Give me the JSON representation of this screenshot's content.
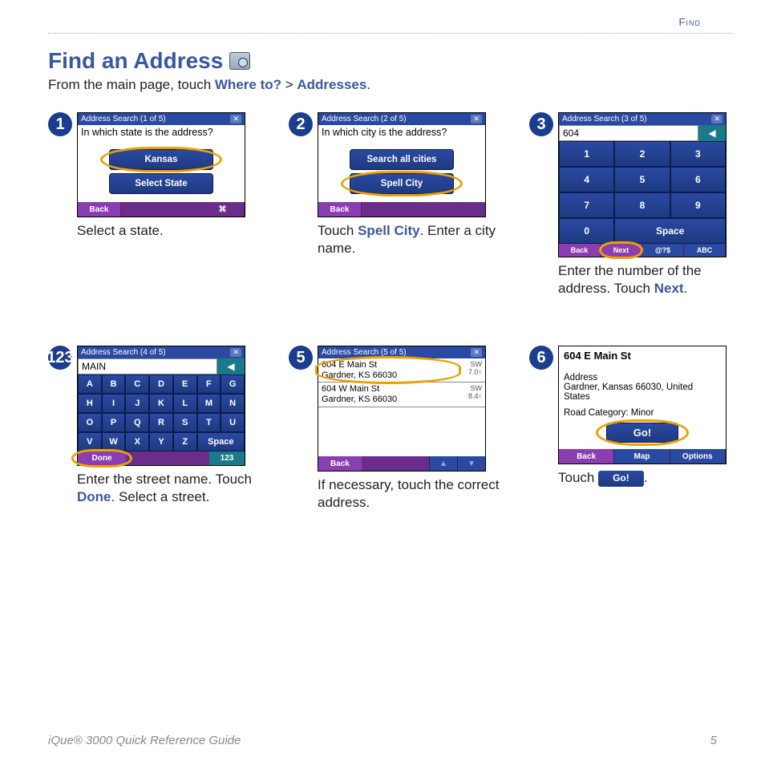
{
  "sectionTab": "Find",
  "heading": "Find an Address",
  "introPre": "From the main page, touch ",
  "introLink1": "Where to?",
  "introMid": " > ",
  "introLink2": "Addresses",
  "introPost": ".",
  "steps": {
    "s1": {
      "num": "1",
      "title": "Address Search  (1 of 5)",
      "prompt": "In which state is the address?",
      "btn1": "Kansas",
      "btn2": "Select State",
      "back": "Back",
      "caption": "Select a state."
    },
    "s2": {
      "num": "2",
      "title": "Address Search  (2 of 5)",
      "prompt": "In which city is the address?",
      "btn1": "Search all cities",
      "btn2": "Spell City",
      "back": "Back",
      "captionPre": "Touch ",
      "captionLink": "Spell City",
      "captionPost": ". Enter a city name."
    },
    "s3": {
      "num": "3",
      "title": "Address Search  (3 of 5)",
      "entered": "604",
      "keys": [
        "1",
        "2",
        "3",
        "4",
        "5",
        "6",
        "7",
        "8",
        "9"
      ],
      "zero": "0",
      "space": "Space",
      "fBack": "Back",
      "fNext": "Next",
      "fSym": "@?$",
      "fAbc": "ABC",
      "captionPre": "Enter the number of the address. Touch ",
      "captionLink": "Next",
      "captionPost": "."
    },
    "s4": {
      "num": "123",
      "title": "Address Search  (4 of 5)",
      "entered": "MAIN",
      "row1": [
        "A",
        "B",
        "C",
        "D",
        "E",
        "F",
        "G"
      ],
      "row2": [
        "H",
        "I",
        "J",
        "K",
        "L",
        "M",
        "N"
      ],
      "row3": [
        "O",
        "P",
        "Q",
        "R",
        "S",
        "T",
        "U"
      ],
      "row4": [
        "V",
        "W",
        "X",
        "Y",
        "Z"
      ],
      "space": "Space",
      "done": "Done",
      "captionPre": "Enter the street name. Touch ",
      "captionLink": "Done",
      "captionPost": ". Select a street."
    },
    "s5": {
      "num": "5",
      "title": "Address Search  (5 of 5)",
      "r1a": "604 E Main St",
      "r1b": "Gardner, KS 66030",
      "r1d": "SW",
      "r1e": "7.0↑",
      "r2a": "604 W Main St",
      "r2b": "Gardner, KS 66030",
      "r2d": "SW",
      "r2e": "8.4↑",
      "back": "Back",
      "caption": "If necessary, touch the correct address."
    },
    "s6": {
      "num": "6",
      "dtitle": "604 E Main St",
      "addrLabel": "Address",
      "addrVal": "Gardner, Kansas 66030, United States",
      "catLabel": "Road Category: Minor",
      "go": "Go!",
      "fBack": "Back",
      "fMap": "Map",
      "fOpt": "Options",
      "captionPre": "Touch ",
      "inlineGo": "Go!",
      "captionPost": "."
    }
  },
  "footerLeft": "iQue® 3000 Quick Reference Guide",
  "footerRight": "5"
}
